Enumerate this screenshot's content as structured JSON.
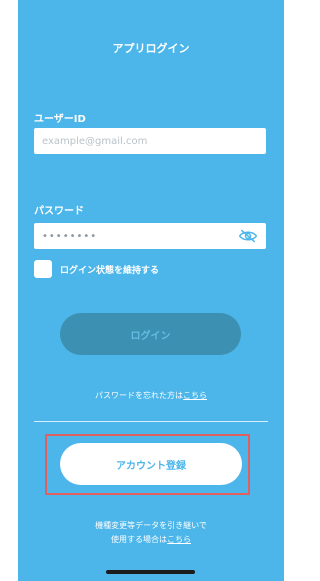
{
  "app": {
    "title": "アプリログイン"
  },
  "form": {
    "userid_label": "ユーザーID",
    "userid_placeholder": "example@gmail.com",
    "password_label": "パスワード",
    "password_value": "••••••••",
    "remember_label": "ログイン状態を維持する",
    "login_button": "ログイン"
  },
  "forgot": {
    "text": "パスワードを忘れた方は",
    "link": "こちら"
  },
  "register": {
    "button": "アカウント登録"
  },
  "migrate": {
    "line1": "機種変更等データを引き継いで",
    "line2": "使用する場合は",
    "link": "こちら"
  },
  "colors": {
    "background": "#4cb6ea",
    "login_button": "#3c90b1",
    "highlight": "#e06060"
  },
  "icons": {
    "password_toggle": "eye-off-icon"
  }
}
